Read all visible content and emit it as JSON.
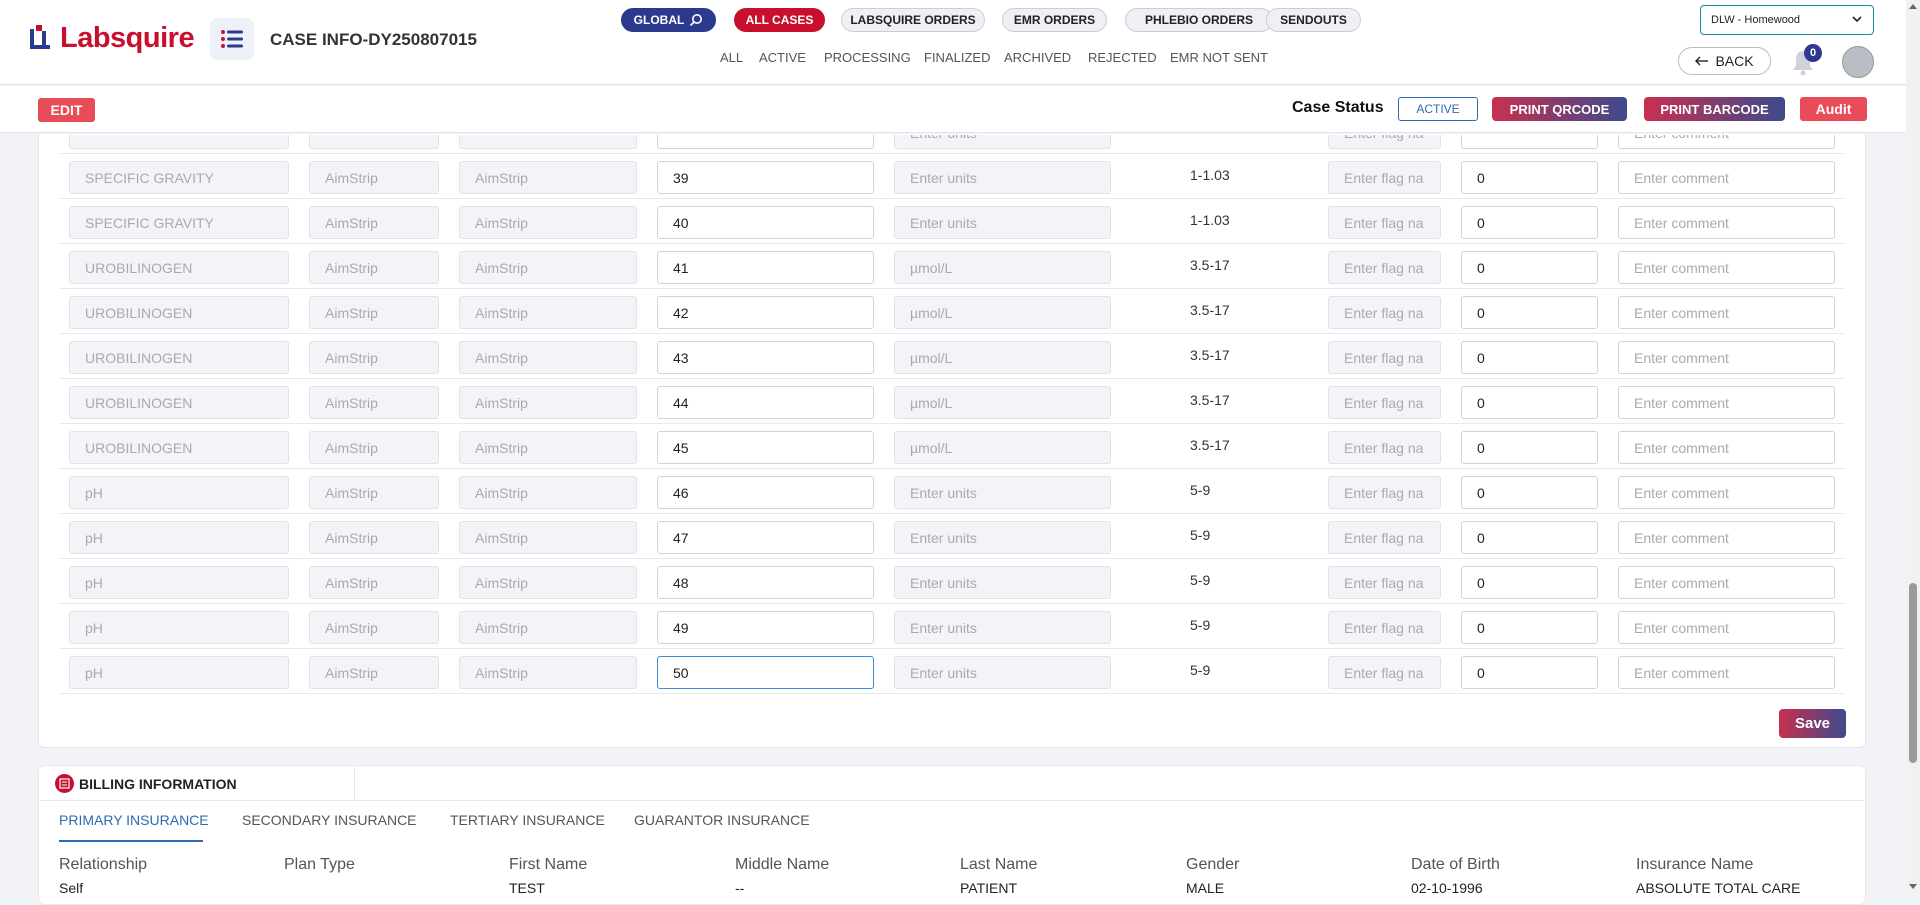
{
  "app": {
    "logo_text": "Labsquire",
    "case_title": "CASE INFO-DY250807015"
  },
  "colors": {
    "brand_red": "#c8102e",
    "brand_navy": "#2b3a8c",
    "accent_blue": "#2b6cb0"
  },
  "header": {
    "pills": [
      {
        "label": "GLOBAL",
        "icon": "search-icon",
        "style": "navy"
      },
      {
        "label": "ALL CASES",
        "style": "red"
      },
      {
        "label": "LABSQUIRE ORDERS",
        "style": "plain"
      },
      {
        "label": "EMR ORDERS",
        "style": "plain"
      },
      {
        "label": "PHLEBIO ORDERS",
        "style": "plain"
      },
      {
        "label": "SENDOUTS",
        "style": "plain"
      }
    ],
    "subnav": [
      "ALL",
      "ACTIVE",
      "PROCESSING",
      "FINALIZED",
      "ARCHIVED",
      "REJECTED",
      "EMR NOT SENT"
    ],
    "location": "DLW - Homewood",
    "back_label": "BACK",
    "notification_count": "0"
  },
  "actionbar": {
    "edit_label": "EDIT",
    "case_status_label": "Case Status",
    "case_status_value": "ACTIVE",
    "print_qr_label": "PRINT QRCODE",
    "print_barcode_label": "PRINT BARCODE",
    "audit_label": "Audit"
  },
  "results": {
    "placeholders": {
      "units": "Enter units",
      "flag": "Enter flag na",
      "comment": "Enter comment"
    },
    "rows": [
      {
        "test": "SPECIFIC GRAVITY",
        "method": "AimStrip",
        "device": "AimStrip",
        "result": "39",
        "units": "",
        "range": "1-1.03",
        "count": "0"
      },
      {
        "test": "SPECIFIC GRAVITY",
        "method": "AimStrip",
        "device": "AimStrip",
        "result": "40",
        "units": "",
        "range": "1-1.03",
        "count": "0"
      },
      {
        "test": "UROBILINOGEN",
        "method": "AimStrip",
        "device": "AimStrip",
        "result": "41",
        "units": "µmol/L",
        "range": "3.5-17",
        "count": "0"
      },
      {
        "test": "UROBILINOGEN",
        "method": "AimStrip",
        "device": "AimStrip",
        "result": "42",
        "units": "µmol/L",
        "range": "3.5-17",
        "count": "0"
      },
      {
        "test": "UROBILINOGEN",
        "method": "AimStrip",
        "device": "AimStrip",
        "result": "43",
        "units": "µmol/L",
        "range": "3.5-17",
        "count": "0"
      },
      {
        "test": "UROBILINOGEN",
        "method": "AimStrip",
        "device": "AimStrip",
        "result": "44",
        "units": "µmol/L",
        "range": "3.5-17",
        "count": "0"
      },
      {
        "test": "UROBILINOGEN",
        "method": "AimStrip",
        "device": "AimStrip",
        "result": "45",
        "units": "µmol/L",
        "range": "3.5-17",
        "count": "0"
      },
      {
        "test": "pH",
        "method": "AimStrip",
        "device": "AimStrip",
        "result": "46",
        "units": "",
        "range": "5-9",
        "count": "0"
      },
      {
        "test": "pH",
        "method": "AimStrip",
        "device": "AimStrip",
        "result": "47",
        "units": "",
        "range": "5-9",
        "count": "0"
      },
      {
        "test": "pH",
        "method": "AimStrip",
        "device": "AimStrip",
        "result": "48",
        "units": "",
        "range": "5-9",
        "count": "0"
      },
      {
        "test": "pH",
        "method": "AimStrip",
        "device": "AimStrip",
        "result": "49",
        "units": "",
        "range": "5-9",
        "count": "0"
      },
      {
        "test": "pH",
        "method": "AimStrip",
        "device": "AimStrip",
        "result": "50",
        "units": "",
        "range": "5-9",
        "count": "0"
      }
    ],
    "save_label": "Save"
  },
  "billing": {
    "title": "BILLING INFORMATION",
    "tabs": [
      "PRIMARY INSURANCE",
      "SECONDARY INSURANCE",
      "TERTIARY INSURANCE",
      "GUARANTOR INSURANCE"
    ],
    "columns": [
      {
        "label": "Relationship",
        "value": "Self"
      },
      {
        "label": "Plan Type",
        "value": ""
      },
      {
        "label": "First Name",
        "value": "TEST"
      },
      {
        "label": "Middle Name",
        "value": "--"
      },
      {
        "label": "Last Name",
        "value": "PATIENT"
      },
      {
        "label": "Gender",
        "value": "MALE"
      },
      {
        "label": "Date of Birth",
        "value": "02-10-1996"
      },
      {
        "label": "Insurance Name",
        "value": "ABSOLUTE TOTAL CARE"
      }
    ]
  }
}
